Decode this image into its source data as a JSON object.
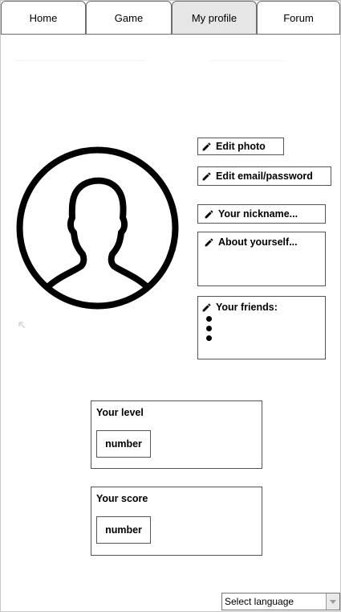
{
  "tabs": [
    {
      "label": "Home",
      "active": false
    },
    {
      "label": "Game",
      "active": false
    },
    {
      "label": "My profile",
      "active": true
    },
    {
      "label": "Forum",
      "active": false
    }
  ],
  "profile": {
    "edit_photo": "Edit photo",
    "edit_email": "Edit email/password",
    "nickname_placeholder": "Your nickname...",
    "about_placeholder": "About yourself...",
    "friends_label": "Your friends:",
    "friends_bullet_count": 3
  },
  "stats": {
    "level_title": "Your level",
    "level_value": "number",
    "score_title": "Your score",
    "score_value": "number"
  },
  "language": {
    "selected": "Select language"
  },
  "icons": {
    "edit": "pencil-icon",
    "avatar": "user-avatar-icon",
    "dropdown": "chevron-down-icon",
    "resize": "resize-arrow-icon"
  },
  "colors": {
    "active_tab": "#e6e6e6",
    "border": "#555555"
  }
}
